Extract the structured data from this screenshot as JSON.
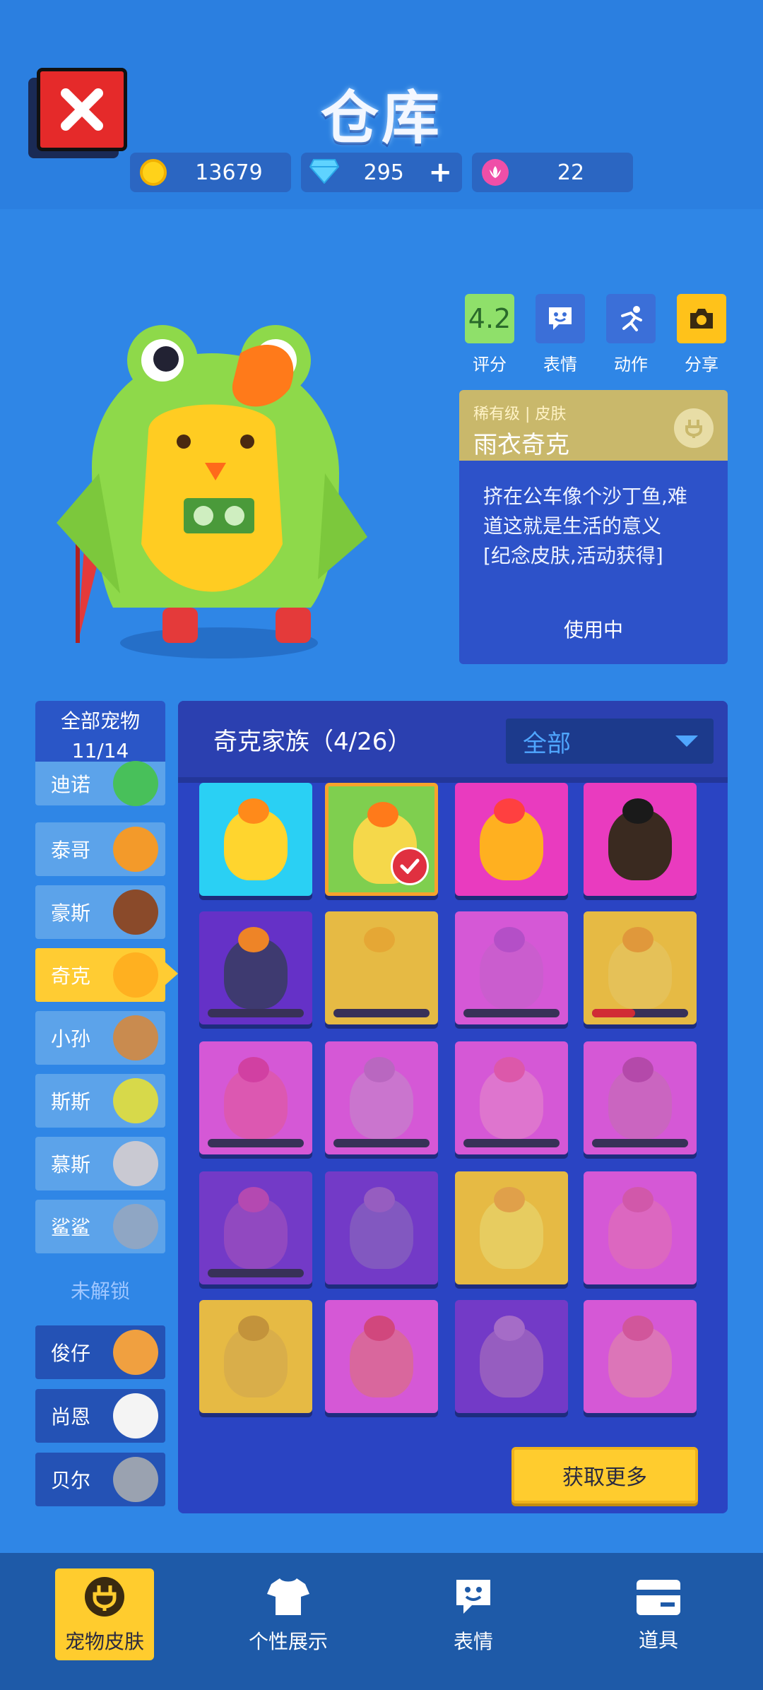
{
  "header": {
    "title": "仓库",
    "currencies": [
      {
        "name": "coin-icon",
        "value": "13679",
        "color": "#ffd21a"
      },
      {
        "name": "diamond-icon",
        "value": "295",
        "color": "#5fd3ff"
      },
      {
        "name": "flower-token-icon",
        "value": "22",
        "color": "#ef4fa8"
      }
    ],
    "add_symbol": "+"
  },
  "actions": [
    {
      "label": "评分",
      "value": "4.2",
      "icon": "rating",
      "color": "#8fe06a"
    },
    {
      "label": "表情",
      "icon": "emote-icon",
      "color": "#3b6fd8"
    },
    {
      "label": "动作",
      "icon": "action-icon",
      "color": "#3b6fd8"
    },
    {
      "label": "分享",
      "icon": "camera-icon",
      "color": "#ffc21a"
    }
  ],
  "skin_card": {
    "rarity": "稀有级 | 皮肤",
    "name": "雨衣奇克",
    "desc_line1": "挤在公车像个沙丁鱼,难",
    "desc_line2": "道这就是生活的意义",
    "desc_line3": "[纪念皮肤,活动获得]",
    "status": "使用中"
  },
  "pets": {
    "all_label": "全部宠物",
    "count": "11/14",
    "unlocked": [
      {
        "name": "迪诺",
        "face": "#48c05a"
      },
      {
        "name": "泰哥",
        "face": "#f39a2a"
      },
      {
        "name": "豪斯",
        "face": "#8a4a2a"
      },
      {
        "name": "奇克",
        "face": "#ffb020"
      },
      {
        "name": "小孙",
        "face": "#c98b4f"
      },
      {
        "name": "斯斯",
        "face": "#d7d94a"
      },
      {
        "name": "慕斯",
        "face": "#c9c9d2"
      },
      {
        "name": "鲨鲨",
        "face": "#8fa6c4"
      }
    ],
    "locked_label": "未解锁",
    "locked": [
      {
        "name": "俊仔",
        "face": "#f0a040"
      },
      {
        "name": "尚恩",
        "face": "#f4f4f4"
      },
      {
        "name": "贝尔",
        "face": "#9aa2b0"
      }
    ]
  },
  "panel": {
    "family_label": "奇克家族（4/26）",
    "filter_value": "全部",
    "more_button": "获取更多",
    "skins": [
      {
        "bg": "#2ad0f4",
        "body": "#ffd52e",
        "tuft": "#ff8a1a",
        "owned": true,
        "progress": null
      },
      {
        "bg": "#7fcf4f",
        "body": "#f5d84a",
        "tuft": "#ff7a1a",
        "owned": true,
        "selected": true,
        "progress": null
      },
      {
        "bg": "#e93bbf",
        "body": "#ffb020",
        "tuft": "#ff4040",
        "owned": true,
        "progress": null
      },
      {
        "bg": "#e93bbf",
        "body": "#3a2a20",
        "tuft": "#1a1a1a",
        "owned": true,
        "progress": null
      },
      {
        "bg": "#6a30c8",
        "body": "#403a6a",
        "tuft": "#ff8a1a",
        "owned": false,
        "progress": 0
      },
      {
        "bg": "#f7c53a",
        "body": "#f7c53a",
        "tuft": "#f5b02a",
        "owned": false,
        "progress": 0
      },
      {
        "bg": "#e45ad8",
        "body": "#d860d0",
        "tuft": "#c050c8",
        "owned": false,
        "progress": 0
      },
      {
        "bg": "#f7c53a",
        "body": "#f5cc50",
        "tuft": "#f0a030",
        "owned": false,
        "progress": 0.45
      },
      {
        "bg": "#e45ad8",
        "body": "#ec5ab0",
        "tuft": "#e040a0",
        "owned": false,
        "progress": 0
      },
      {
        "bg": "#e45ad8",
        "body": "#d87ad0",
        "tuft": "#c66ac0",
        "owned": false,
        "progress": 0
      },
      {
        "bg": "#e45ad8",
        "body": "#ee7ad0",
        "tuft": "#ec5aa8",
        "owned": false,
        "progress": 0
      },
      {
        "bg": "#e45ad8",
        "body": "#d868c0",
        "tuft": "#c04aa8",
        "owned": false,
        "progress": 0
      },
      {
        "bg": "#7a3ac8",
        "body": "#9a4ac0",
        "tuft": "#c04ab0",
        "owned": false,
        "progress": 0
      },
      {
        "bg": "#7a3ac8",
        "body": "#8a5ac0",
        "tuft": "#a060c0",
        "owned": false,
        "progress": null
      },
      {
        "bg": "#f7c53a",
        "body": "#f8d858",
        "tuft": "#f0a840",
        "owned": false,
        "progress": null
      },
      {
        "bg": "#e45ad8",
        "body": "#ec6ac0",
        "tuft": "#e05aa8",
        "owned": false,
        "progress": null
      },
      {
        "bg": "#f7c53a",
        "body": "#e8b840",
        "tuft": "#d09a30",
        "owned": false,
        "progress": null
      },
      {
        "bg": "#e45ad8",
        "body": "#e86a9a",
        "tuft": "#e04878",
        "owned": false,
        "progress": null
      },
      {
        "bg": "#7a3ac8",
        "body": "#a060c0",
        "tuft": "#b070c8",
        "owned": false,
        "progress": null
      },
      {
        "bg": "#e45ad8",
        "body": "#ec7ab8",
        "tuft": "#e05898",
        "owned": false,
        "progress": null
      }
    ]
  },
  "bottom_nav": [
    {
      "label": "宠物皮肤",
      "icon": "pet-skin-icon",
      "active": true
    },
    {
      "label": "个性展示",
      "icon": "shirt-icon",
      "active": false
    },
    {
      "label": "表情",
      "icon": "emote-icon",
      "active": false
    },
    {
      "label": "道具",
      "icon": "card-icon",
      "active": false
    }
  ]
}
